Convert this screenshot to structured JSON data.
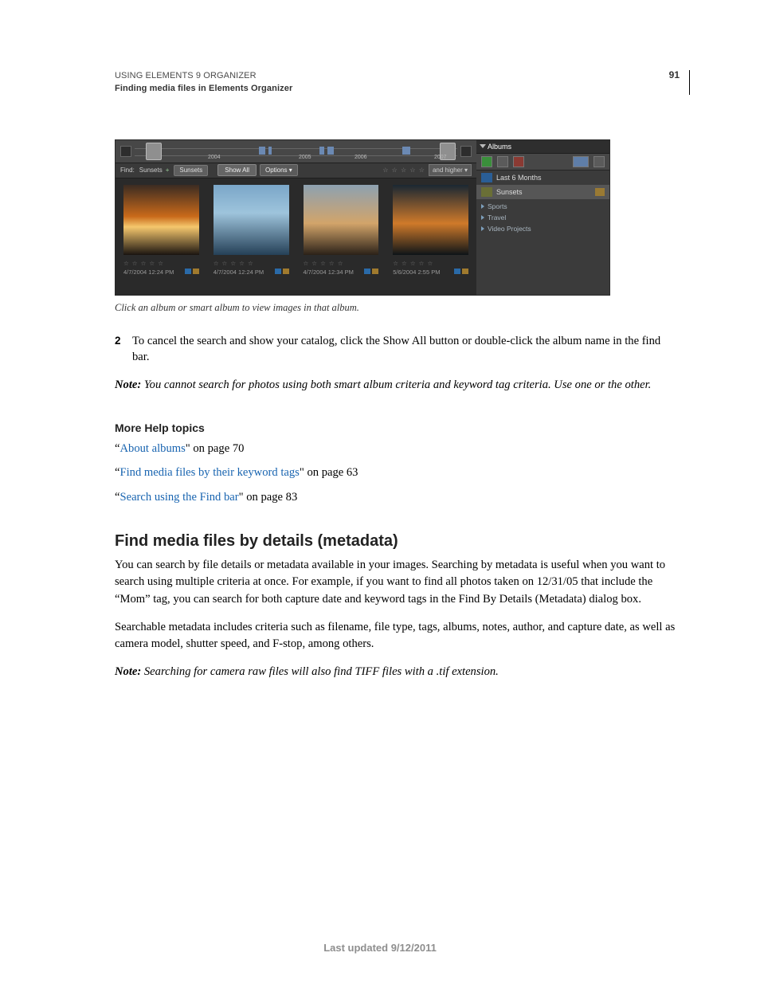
{
  "header": {
    "line1": "USING ELEMENTS 9 ORGANIZER",
    "line2": "Finding media files in Elements Organizer",
    "page_number": "91"
  },
  "figure": {
    "timeline": {
      "years": [
        "2004",
        "2005",
        "2006",
        "2007"
      ]
    },
    "find_bar": {
      "label": "Find:",
      "term": "Sunsets",
      "tag_chip": "Sunsets",
      "show_all": "Show All",
      "options": "Options ▾",
      "rating_dd": "and higher  ▾"
    },
    "thumbs": [
      {
        "date": "4/7/2004 12:24 PM"
      },
      {
        "date": "4/7/2004 12:24 PM"
      },
      {
        "date": "4/7/2004 12:34 PM"
      },
      {
        "date": "5/6/2004 2:55 PM"
      }
    ],
    "panel": {
      "title": "Albums",
      "smart1": "Last 6 Months",
      "smart2": "Sunsets",
      "items": [
        "Sports",
        "Travel",
        "Video Projects"
      ]
    },
    "caption": "Click an album or smart album to view images in that album."
  },
  "step2": {
    "num": "2",
    "text": "To cancel the search and show your catalog, click the Show All button or double-click the album name in the find bar."
  },
  "note1": {
    "label": "Note:",
    "text": " You cannot search for photos using both smart album criteria and keyword tag criteria. Use one or the other."
  },
  "more_help": {
    "heading": "More Help topics",
    "refs": [
      {
        "link": "About albums",
        "suffix": "\" on page 70"
      },
      {
        "link": "Find media files by their keyword tags",
        "suffix": "\" on page 63"
      },
      {
        "link": "Search using the Find bar",
        "suffix": "\" on page 83"
      }
    ]
  },
  "section": {
    "heading": "Find media files by details (metadata)",
    "p1": "You can search by file details or metadata available in your images. Searching by metadata is useful when you want to search using multiple criteria at once. For example, if you want to find all photos taken on 12/31/05 that include the “Mom” tag, you can search for both capture date and keyword tags in the Find By Details (Metadata) dialog box.",
    "p2": "Searchable metadata includes criteria such as filename, file type, tags, albums, notes, author, and capture date, as well as camera model, shutter speed, and F-stop, among others."
  },
  "note2": {
    "label": "Note:",
    "text": " Searching for camera raw files will also find TIFF files with a .tif extension."
  },
  "footer": "Last updated 9/12/2011",
  "quote": "“"
}
